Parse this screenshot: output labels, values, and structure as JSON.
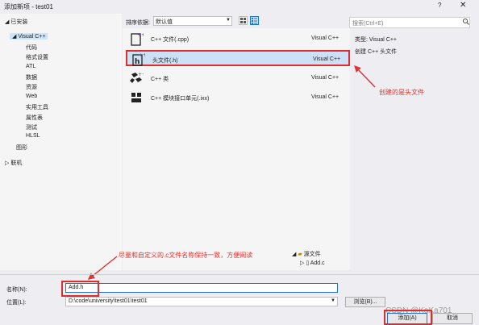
{
  "window": {
    "title": "添加新项 - test01",
    "help": "?",
    "close": "✕"
  },
  "tree": [
    {
      "label": "已安装",
      "expanded": true
    },
    {
      "label": "Visual C++",
      "expanded": true,
      "selected": true
    },
    {
      "label": "代码"
    },
    {
      "label": "格式设置"
    },
    {
      "label": "ATL"
    },
    {
      "label": "数据"
    },
    {
      "label": "资源"
    },
    {
      "label": "Web"
    },
    {
      "label": "实用工具"
    },
    {
      "label": "属性表"
    },
    {
      "label": "测试"
    },
    {
      "label": "HLSL"
    },
    {
      "label": "图形"
    },
    {
      "label": "联机",
      "expanded": false
    }
  ],
  "toolbar": {
    "sort_label": "排序依据:",
    "sort_value": "默认值"
  },
  "search": {
    "placeholder": "搜索(Ctrl+E)"
  },
  "templates": [
    {
      "name": "C++ 文件(.cpp)",
      "type": "Visual C++",
      "icon": "cpp-file-icon"
    },
    {
      "name": "头文件(.h)",
      "type": "Visual C++",
      "icon": "header-file-icon",
      "selected": true
    },
    {
      "name": "C++ 类",
      "type": "Visual C++",
      "icon": "class-icon"
    },
    {
      "name": "C++ 模块接口单元(.ixx)",
      "type": "Visual C++",
      "icon": "module-icon"
    }
  ],
  "details": {
    "type_line": "类型: Visual C++",
    "desc_line": "创建 C++ 头文件"
  },
  "solution": {
    "folder": "源文件",
    "file": "Add.c"
  },
  "annotations": {
    "header": "创建的是头文件",
    "naming": "尽量和自定义的.c文件名称保持一致，方便阅读"
  },
  "form": {
    "name_label": "名称(N):",
    "name_value": "Add.h",
    "location_label": "位置(L):",
    "location_value": "D:\\code\\university\\test01\\test01",
    "browse_label": "浏览(B)...",
    "add_label": "添加(A)",
    "cancel_label": "取消"
  },
  "watermark": "CSDN @KaKa701",
  "colors": {
    "accent": "#2f6fd4",
    "annotation": "#e0332f",
    "selection": "#cde0f5"
  }
}
